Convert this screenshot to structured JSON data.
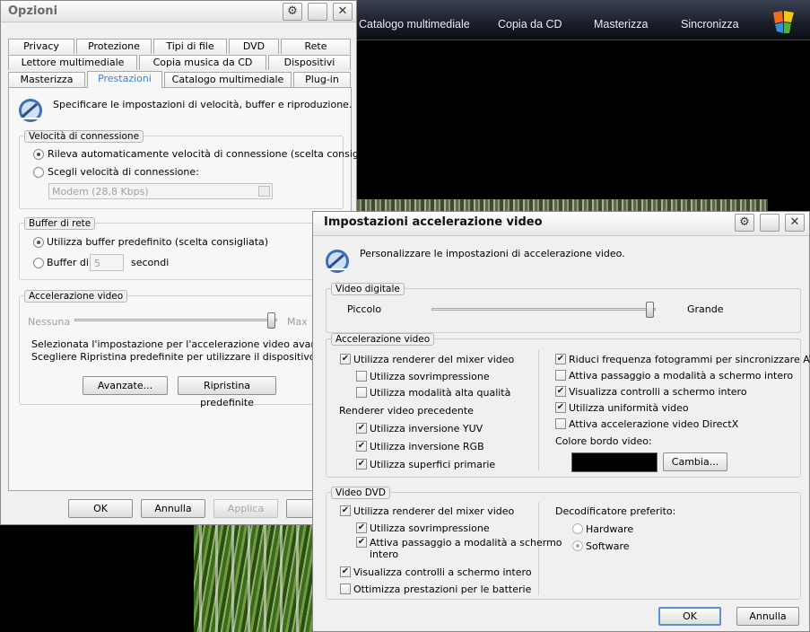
{
  "media_player": {
    "tabs": [
      "Catalogo multimediale",
      "Copia da CD",
      "Masterizza",
      "Sincronizza"
    ]
  },
  "options": {
    "title": "Opzioni",
    "tabs_row1": [
      "Privacy",
      "Protezione",
      "Tipi di file",
      "DVD",
      "Rete"
    ],
    "tabs_row2": [
      "Lettore multimediale",
      "Copia musica da CD",
      "Dispositivi"
    ],
    "tabs_row3": [
      "Masterizza",
      "Prestazioni",
      "Catalogo multimediale",
      "Plug-in"
    ],
    "description": "Specificare le impostazioni di velocità, buffer e riproduzione.",
    "connection": {
      "title": "Velocità di connessione",
      "auto": "Rileva automaticamente velocità di connessione (scelta consigliata)",
      "choose": "Scegli velocità di connessione:",
      "speed_value": "Modem (28,8 Kbps)"
    },
    "buffer": {
      "title": "Buffer di rete",
      "default": "Utilizza buffer predefinito (scelta consigliata)",
      "custom": "Buffer di",
      "seconds_value": "5",
      "seconds_label": "secondi"
    },
    "acceleration": {
      "title": "Accelerazione video",
      "min_label": "Nessuna",
      "max_label": "Max",
      "level": 1.0,
      "text_line1": "Selezionata l'impostazione per l'accelerazione video avanzata.",
      "text_line2": "Scegliere Ripristina predefinite per utilizzare il dispositivo di",
      "advanced_button": "Avanzate...",
      "restore_button": "Ripristina predefinite"
    },
    "buttons": {
      "ok": "OK",
      "cancel": "Annulla",
      "apply": "Applica"
    }
  },
  "accel_dialog": {
    "title": "Impostazioni accelerazione video",
    "description": "Personalizzare le impostazioni di accelerazione video.",
    "digital_video": {
      "title": "Video digitale",
      "small": "Piccolo",
      "large": "Grande",
      "level": 1.0
    },
    "video_accel": {
      "title": "Accelerazione video",
      "mixer": "Utilizza renderer del mixer video",
      "overlay": "Utilizza sovrimpressione",
      "hq_mode": "Utilizza modalità alta qualità",
      "legacy_title": "Renderer video precedente",
      "yuv": "Utilizza inversione YUV",
      "rgb": "Utilizza inversione RGB",
      "primary": "Utilizza superfici primarie",
      "reduce_fps": "Riduci frequenza fotogrammi per sincronizzare AV",
      "fullscreen_switch": "Attiva passaggio a modalità a schermo intero",
      "fullscreen_controls": "Visualizza controlli a schermo intero",
      "uniformity": "Utilizza uniformità video",
      "directx": "Attiva accelerazione video DirectX",
      "border_color_label": "Colore bordo video:",
      "border_color": "#000000",
      "change_button": "Cambia..."
    },
    "dvd": {
      "title": "Video DVD",
      "mixer": "Utilizza renderer del mixer video",
      "overlay": "Utilizza sovrimpressione",
      "fullscreen_switch_l1": "Attiva passaggio a modalità a schermo",
      "fullscreen_switch_l2": "intero",
      "fullscreen_controls": "Visualizza controlli a schermo intero",
      "battery": "Ottimizza prestazioni per le batterie",
      "decoder_title": "Decodificatore preferito:",
      "hardware": "Hardware",
      "software": "Software"
    },
    "buttons": {
      "ok": "OK",
      "cancel": "Annulla"
    }
  },
  "checkmark": "✔",
  "icons": {
    "close": "✕",
    "gear": "⚙"
  }
}
